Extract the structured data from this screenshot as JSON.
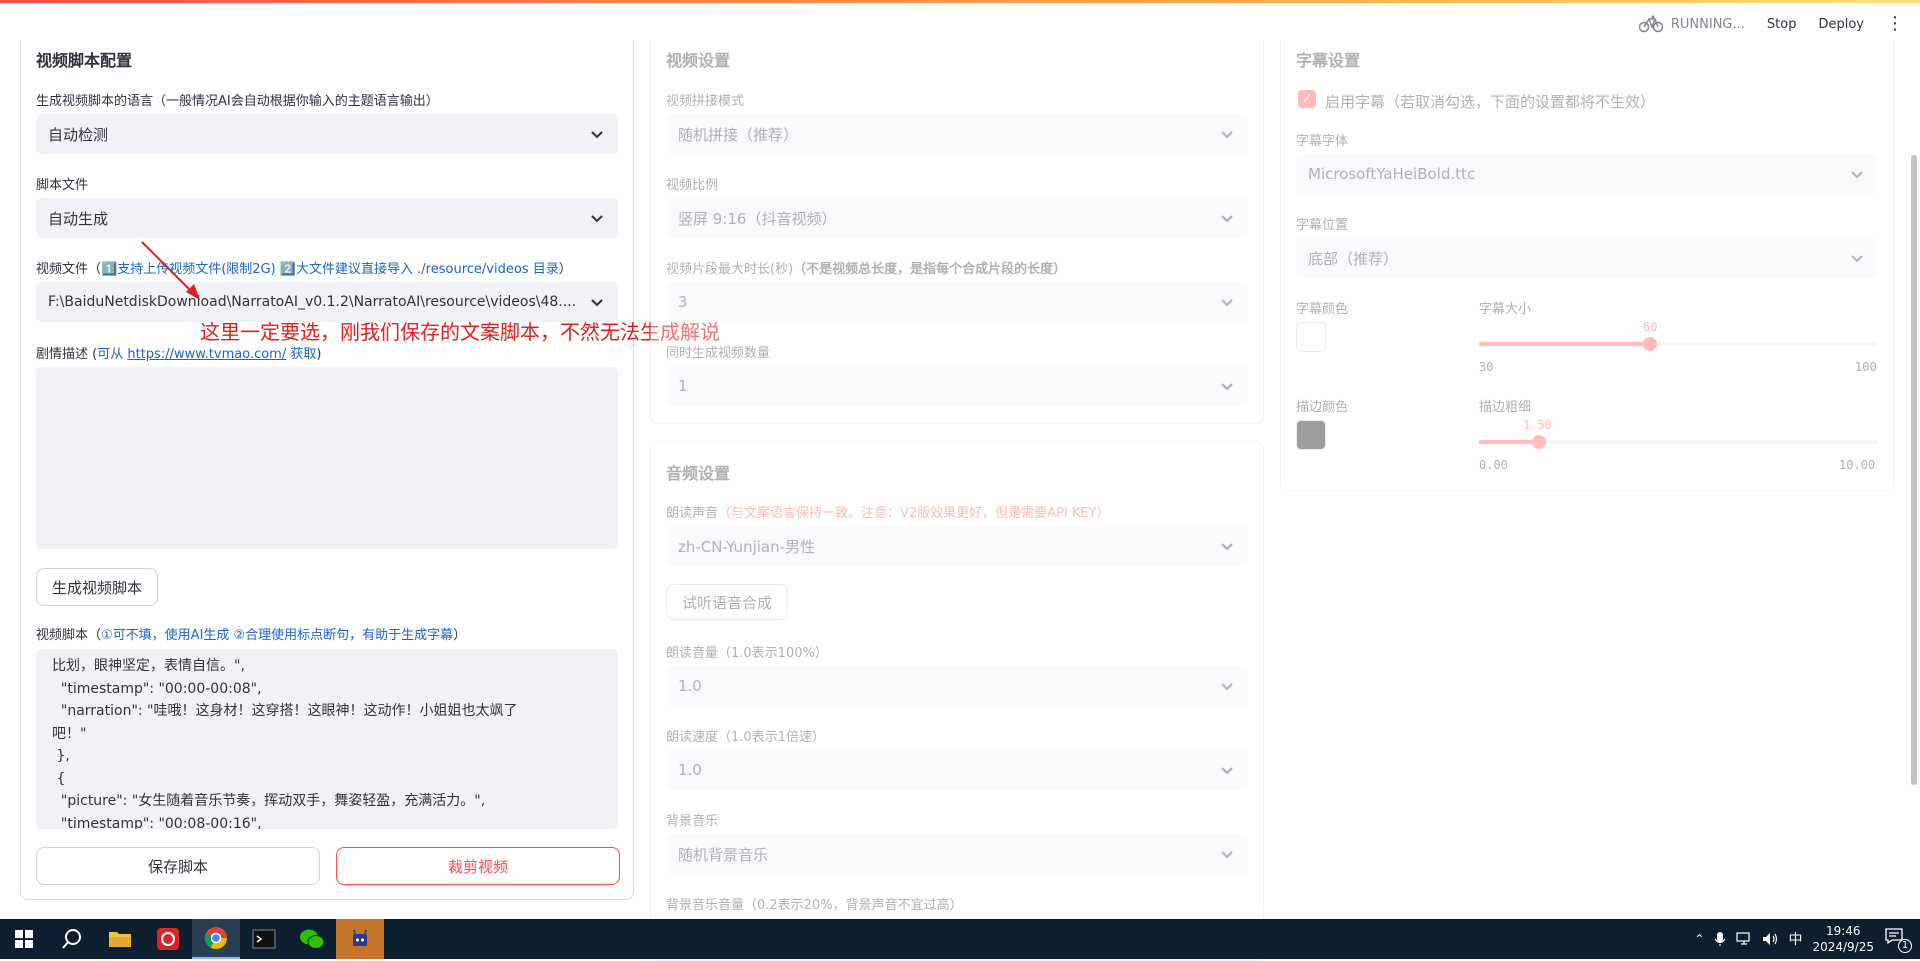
{
  "header": {
    "status": "RUNNING...",
    "stop_label": "Stop",
    "deploy_label": "Deploy"
  },
  "script_panel": {
    "title": "视频脚本配置",
    "language_label": "生成视频脚本的语言（一般情况AI会自动根据你输入的主题语言输出）",
    "language_value": "自动检测",
    "script_file_label": "脚本文件",
    "script_file_value": "自动生成",
    "video_file_label_prefix": "视频文件（",
    "video_file_hint1": "1️⃣支持上传视频文件(限制2G)",
    "video_file_hint2": "2️⃣大文件建议直接导入 ./resource/videos 目录",
    "video_file_label_suffix": "）",
    "video_file_value": "F:\\BaiduNetdiskDownload\\NarratoAI_v0.1.2\\NarratoAI\\resource\\videos\\48....",
    "annotation": "这里一定要选，刚我们保存的文案脚本，不然无法生成解说",
    "plot_label_prefix": "剧情描述 (",
    "plot_label_from": "可从 ",
    "plot_link": "https://www.tvmao.com/",
    "plot_label_get": " 获取",
    "plot_label_suffix": ")",
    "generate_button": "生成视频脚本",
    "video_script_label_prefix": "视频脚本（",
    "video_script_hint": "①可不填，使用AI生成  ②合理使用标点断句，有助于生成字幕",
    "video_script_label_suffix": "）",
    "video_script_text": "比划，眼神坚定，表情自信。\",\n  \"timestamp\": \"00:00-00:08\",\n  \"narration\": \"哇哦！这身材！这穿搭！这眼神！这动作！小姐姐也太飒了\n吧！\"\n },\n {\n  \"picture\": \"女生随着音乐节奏，挥动双手，舞姿轻盈，充满活力。\",\n  \"timestamp\": \"00:08-00:16\",",
    "save_button": "保存脚本",
    "crop_button": "裁剪视频"
  },
  "video_panel": {
    "title": "视频设置",
    "concat_label": "视频拼接模式",
    "concat_value": "随机拼接（推荐）",
    "ratio_label": "视频比例",
    "ratio_value": "竖屏 9:16（抖音视频）",
    "max_len_label": "视频片段最大时长(秒)",
    "max_len_note": "（不是视频总长度，是指每个合成片段的长度）",
    "max_len_value": "3",
    "count_label": "同时生成视频数量",
    "count_value": "1"
  },
  "audio_panel": {
    "title": "音频设置",
    "voice_label": "朗读声音",
    "voice_note": "（与文案语言保持一致。注意：V2版效果更好，但是需要API KEY）",
    "voice_value": "zh-CN-Yunjian-男性",
    "test_button": "试听语音合成",
    "volume_label": "朗读音量（1.0表示100%）",
    "volume_value": "1.0",
    "speed_label": "朗读速度（1.0表示1倍速）",
    "speed_value": "1.0",
    "bgm_label": "背景音乐",
    "bgm_value": "随机背景音乐",
    "bgm_volume_label": "背景音乐音量（0.2表示20%，背景声音不宜过高）"
  },
  "subtitle_panel": {
    "title": "字幕设置",
    "enable_label": "启用字幕（若取消勾选，下面的设置都将不生效）",
    "font_label": "字幕字体",
    "font_value": "MicrosoftYaHeiBold.ttc",
    "position_label": "字幕位置",
    "position_value": "底部（推荐）",
    "color_label": "字幕颜色",
    "size_label": "字幕大小",
    "size_value": "60",
    "size_min": "30",
    "size_max": "100",
    "size_fraction": 0.4286,
    "stroke_color_label": "描边颜色",
    "stroke_width_label": "描边粗细",
    "stroke_value": "1.50",
    "stroke_min": "0.00",
    "stroke_max": "10.00",
    "stroke_fraction": 0.15
  },
  "taskbar": {
    "time": "19:46",
    "date": "2024/9/25",
    "ime": "中",
    "notification_count": "1"
  },
  "colors": {
    "accent": "#ff4b4b",
    "input_bg": "#f0f2f6",
    "link": "#1c66c8"
  }
}
